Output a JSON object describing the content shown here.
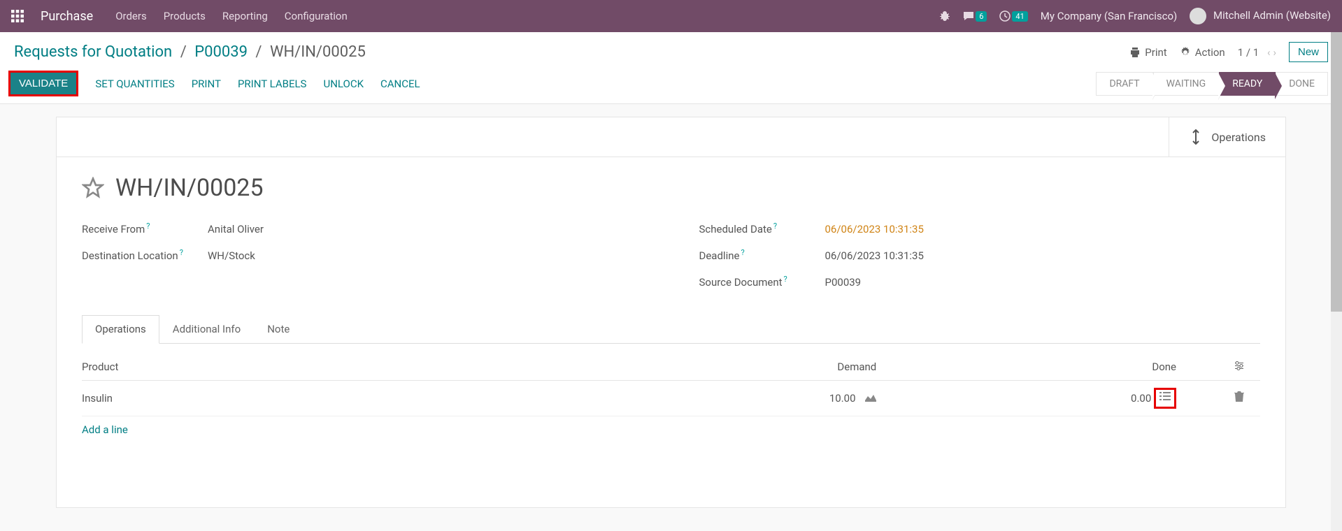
{
  "navbar": {
    "app_name": "Purchase",
    "menu": [
      "Orders",
      "Products",
      "Reporting",
      "Configuration"
    ],
    "messages_count": "6",
    "activities_count": "41",
    "company": "My Company (San Francisco)",
    "user": "Mitchell Admin (Website)"
  },
  "breadcrumb": {
    "root": "Requests for Quotation",
    "parent": "P00039",
    "current": "WH/IN/00025"
  },
  "header_actions": {
    "print": "Print",
    "action": "Action",
    "pager": "1 / 1",
    "new": "New"
  },
  "actions": {
    "validate": "VALIDATE",
    "set_quantities": "SET QUANTITIES",
    "print": "PRINT",
    "print_labels": "PRINT LABELS",
    "unlock": "UNLOCK",
    "cancel": "CANCEL"
  },
  "status": {
    "steps": [
      "DRAFT",
      "WAITING",
      "READY",
      "DONE"
    ],
    "active": "READY"
  },
  "sheet": {
    "operations_btn": "Operations",
    "title": "WH/IN/00025",
    "fields_left": {
      "receive_from_label": "Receive From",
      "receive_from": "Anital Oliver",
      "destination_label": "Destination Location",
      "destination": "WH/Stock"
    },
    "fields_right": {
      "scheduled_label": "Scheduled Date",
      "scheduled": "06/06/2023 10:31:35",
      "deadline_label": "Deadline",
      "deadline": "06/06/2023 10:31:35",
      "source_label": "Source Document",
      "source": "P00039"
    },
    "tabs": [
      "Operations",
      "Additional Info",
      "Note"
    ],
    "active_tab": "Operations",
    "table": {
      "headers": {
        "product": "Product",
        "demand": "Demand",
        "done": "Done"
      },
      "rows": [
        {
          "product": "Insulin",
          "demand": "10.00",
          "done": "0.00"
        }
      ],
      "add_line": "Add a line"
    }
  }
}
